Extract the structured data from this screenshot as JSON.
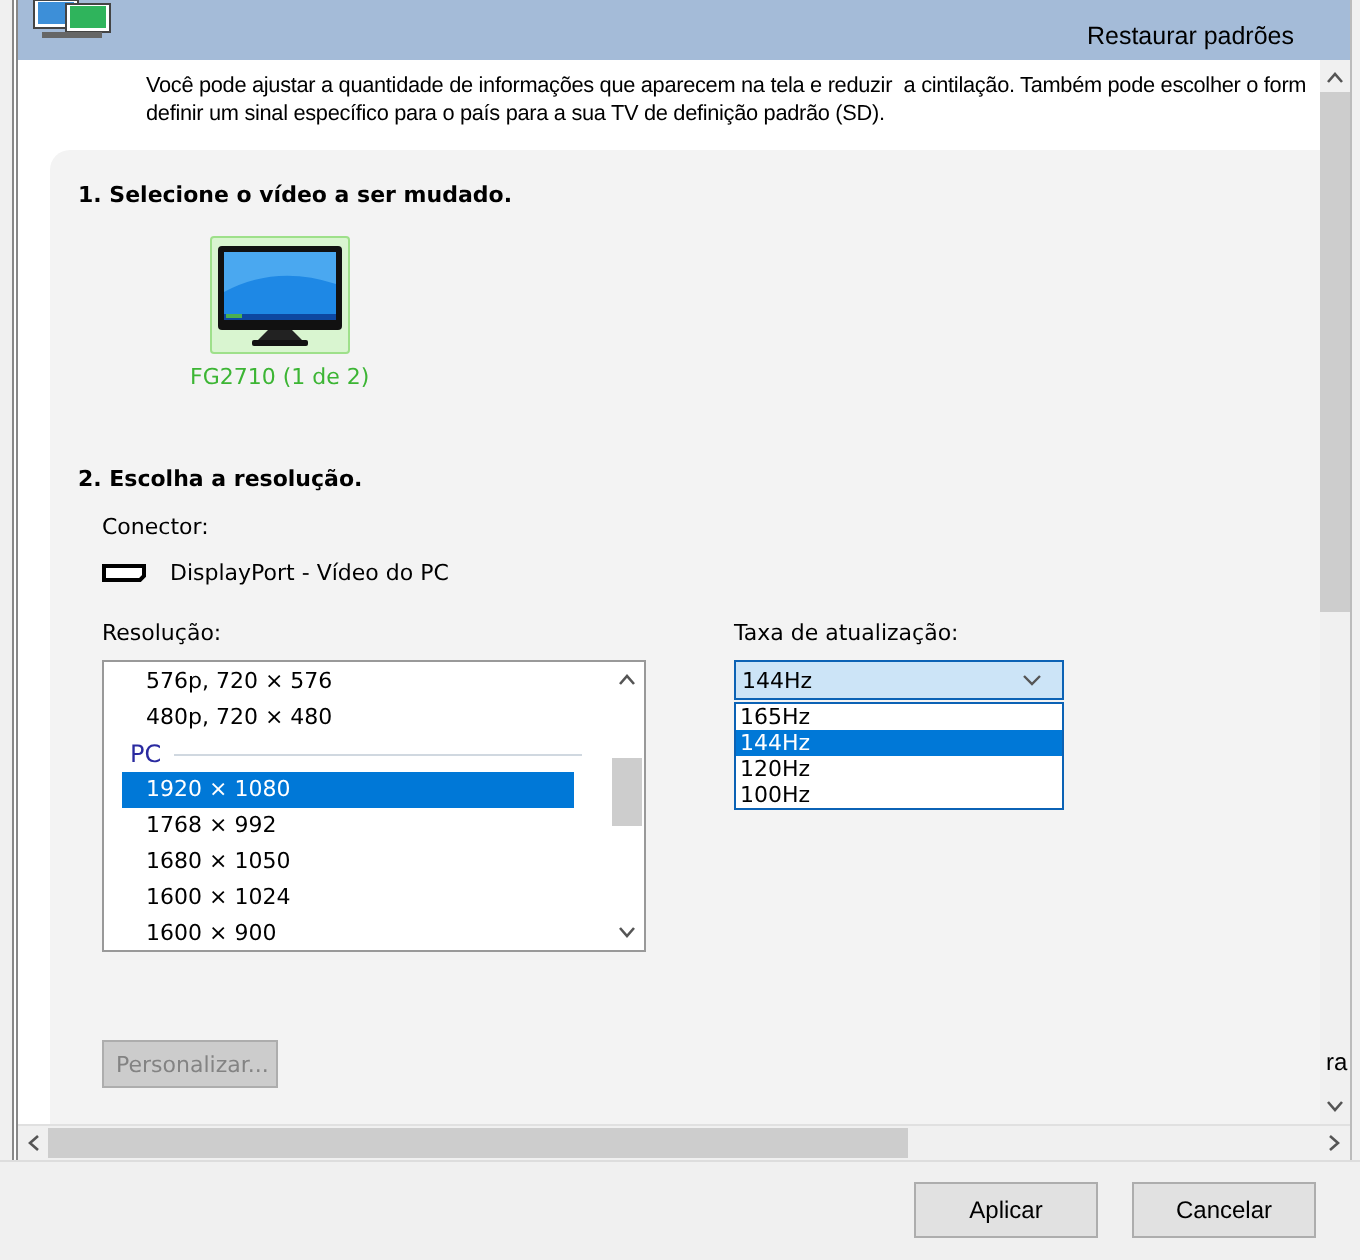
{
  "header": {
    "restore_link": "Restaurar padrões"
  },
  "description": "Você pode ajustar a quantidade de informações que aparecem na tela e reduzir  a cintilação. Também pode escolher o form\ndefinir um sinal específico para o país para a sua TV de definição padrão (SD).",
  "section1": {
    "title": "1. Selecione o vídeo a ser mudado.",
    "displays": [
      {
        "label": "FG2710 (1 de 2)",
        "selected": true
      }
    ]
  },
  "section2": {
    "title": "2. Escolha a resolução.",
    "connector_label": "Conector:",
    "connector": "DisplayPort - Vídeo do PC",
    "resolution_label": "Resolução:",
    "resolutions": [
      {
        "kind": "item",
        "label": "576p, 720 × 576",
        "selected": false
      },
      {
        "kind": "item",
        "label": "480p, 720 × 480",
        "selected": false
      },
      {
        "kind": "group",
        "label": "PC"
      },
      {
        "kind": "item",
        "label": "1920 × 1080",
        "selected": true
      },
      {
        "kind": "item",
        "label": "1768 × 992",
        "selected": false
      },
      {
        "kind": "item",
        "label": "1680 × 1050",
        "selected": false
      },
      {
        "kind": "item",
        "label": "1600 × 1024",
        "selected": false
      },
      {
        "kind": "item",
        "label": "1600 × 900",
        "selected": false
      }
    ],
    "refresh_label": "Taxa de atualização:",
    "refresh_value": "144Hz",
    "refresh_open": true,
    "refresh_options": [
      {
        "label": "165Hz",
        "selected": false
      },
      {
        "label": "144Hz",
        "selected": true
      },
      {
        "label": "120Hz",
        "selected": false
      },
      {
        "label": "100Hz",
        "selected": false
      }
    ],
    "customize_button": {
      "label": "Personalizar...",
      "disabled": true
    }
  },
  "edge_fragment": "ra",
  "buttons": [
    {
      "label": "Aplicar"
    },
    {
      "label": "Cancelar"
    }
  ]
}
